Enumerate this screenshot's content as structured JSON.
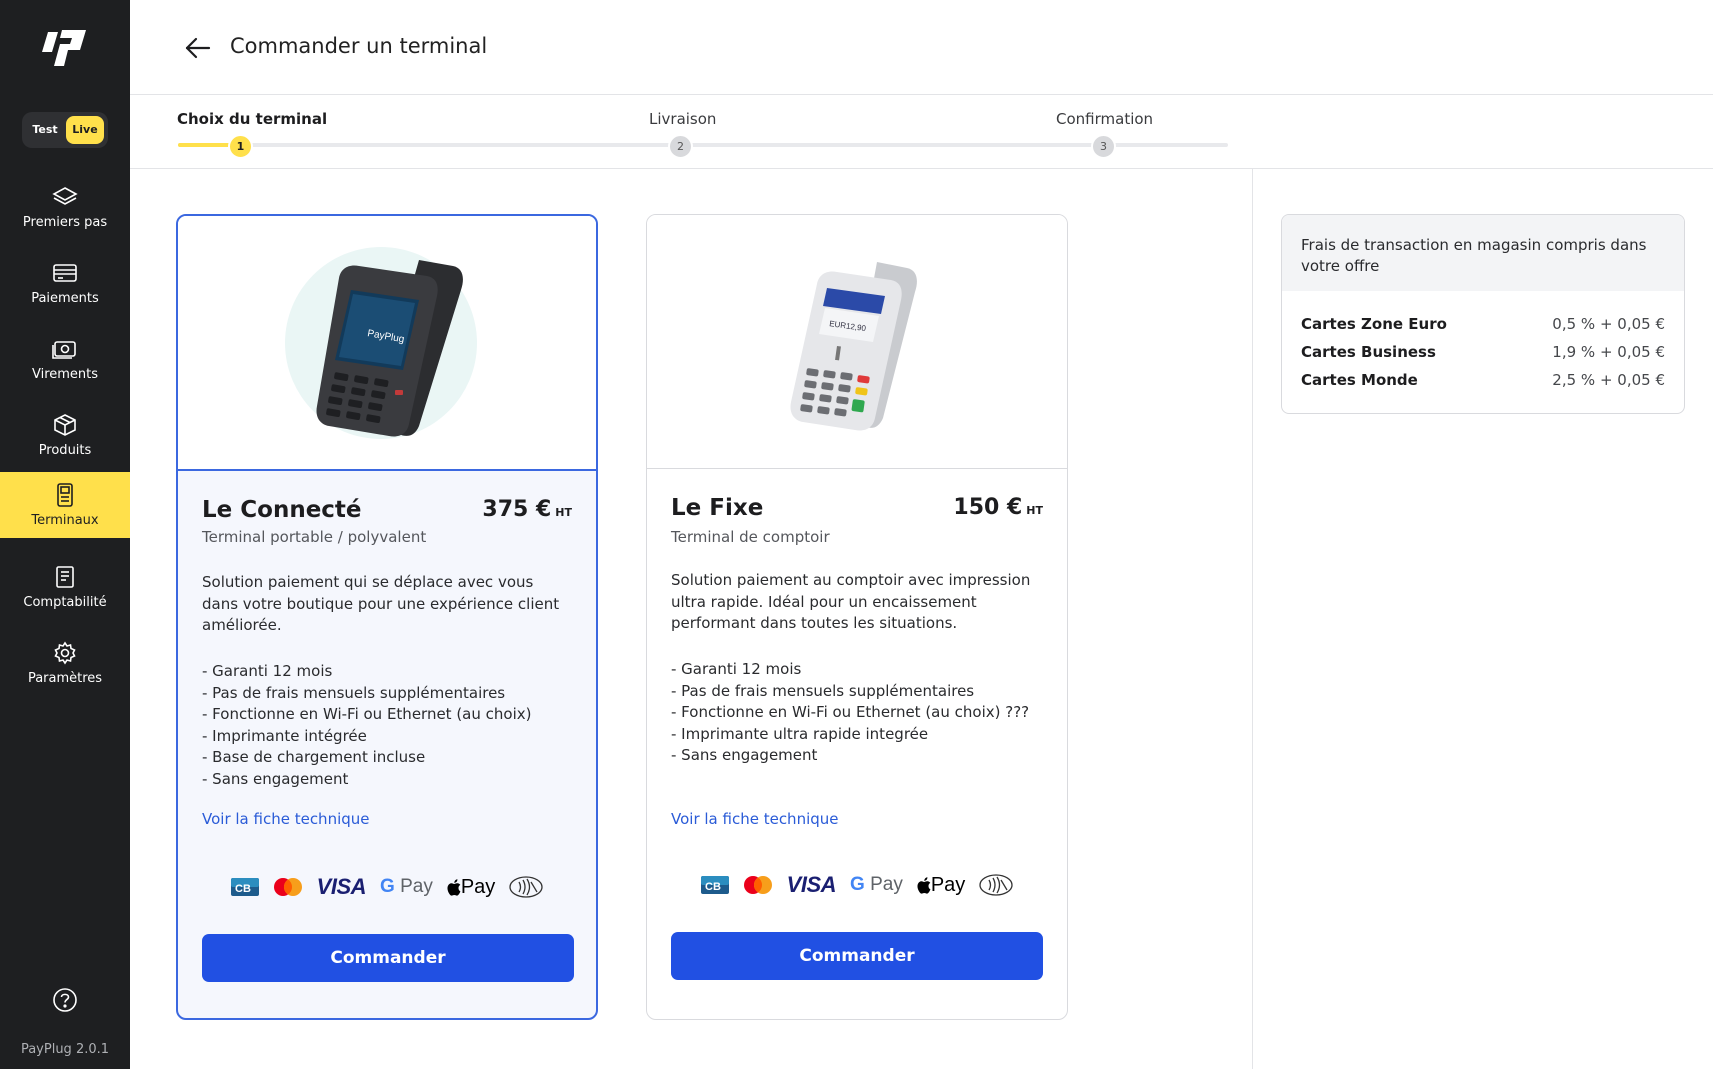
{
  "app": {
    "name": "PayPlug",
    "version": "PayPlug 2.0.1",
    "accent_color": "#ffe04b",
    "primary_color": "#2150e3",
    "sidebar_color": "#1e1f21"
  },
  "mode_toggle": {
    "test_label": "Test",
    "live_label": "Live",
    "selected": "Live"
  },
  "sidebar": {
    "items": [
      {
        "label": "Premiers pas",
        "icon": "layers-icon"
      },
      {
        "label": "Paiements",
        "icon": "credit-card-icon"
      },
      {
        "label": "Virements",
        "icon": "banknote-icon"
      },
      {
        "label": "Produits",
        "icon": "box-icon"
      },
      {
        "label": "Terminaux",
        "icon": "terminal-icon",
        "active": true
      },
      {
        "label": "Comptabilité",
        "icon": "receipt-icon"
      },
      {
        "label": "Paramètres",
        "icon": "gear-icon"
      }
    ],
    "help_icon": "help-icon"
  },
  "header": {
    "title": "Commander un terminal"
  },
  "stepper": {
    "steps": [
      {
        "label": "Choix du terminal",
        "number": "1",
        "active": true
      },
      {
        "label": "Livraison",
        "number": "2"
      },
      {
        "label": "Confirmation",
        "number": "3"
      }
    ]
  },
  "cards": [
    {
      "name": "Le Connecté",
      "price": "375 €",
      "price_suffix": "HT",
      "subtitle": "Terminal portable / polyvalent",
      "description": "Solution paiement qui se déplace avec vous dans votre boutique pour une expérience client améliorée.",
      "features": [
        "- Garanti 12 mois",
        "- Pas de frais mensuels supplémentaires",
        "- Fonctionne en Wi-Fi ou Ethernet (au choix)",
        "- Imprimante intégrée",
        "- Base de chargement incluse",
        "- Sans engagement"
      ],
      "link": "Voir la fiche technique",
      "button": "Commander",
      "device_brand": "PayPlug",
      "selected": true
    },
    {
      "name": "Le Fixe",
      "price": "150 €",
      "price_suffix": "HT",
      "subtitle": "Terminal de comptoir",
      "description": "Solution paiement au comptoir avec impression ultra rapide. Idéal pour un encaissement performant dans toutes les situations.",
      "features": [
        "- Garanti 12 mois",
        "- Pas de frais mensuels supplémentaires",
        "- Fonctionne en Wi-Fi ou Ethernet (au choix) ???",
        "- Imprimante ultra rapide integrée",
        "- Sans engagement"
      ],
      "link": "Voir la fiche technique",
      "button": "Commander",
      "selected": false
    }
  ],
  "payment_methods": {
    "cb": "cb-logo-icon",
    "mastercard": "mastercard-logo-icon",
    "visa": "VISA",
    "gpay_g": "G",
    "gpay": "Pay",
    "applepay": "Pay",
    "contactless": "contactless-icon"
  },
  "fees": {
    "title": "Frais de transaction en magasin compris dans votre offre",
    "rows": [
      {
        "label": "Cartes Zone Euro",
        "value": "0,5 % + 0,05 €"
      },
      {
        "label": "Cartes Business",
        "value": "1,9 % + 0,05 €"
      },
      {
        "label": "Cartes Monde",
        "value": "2,5 % + 0,05 €"
      }
    ]
  }
}
